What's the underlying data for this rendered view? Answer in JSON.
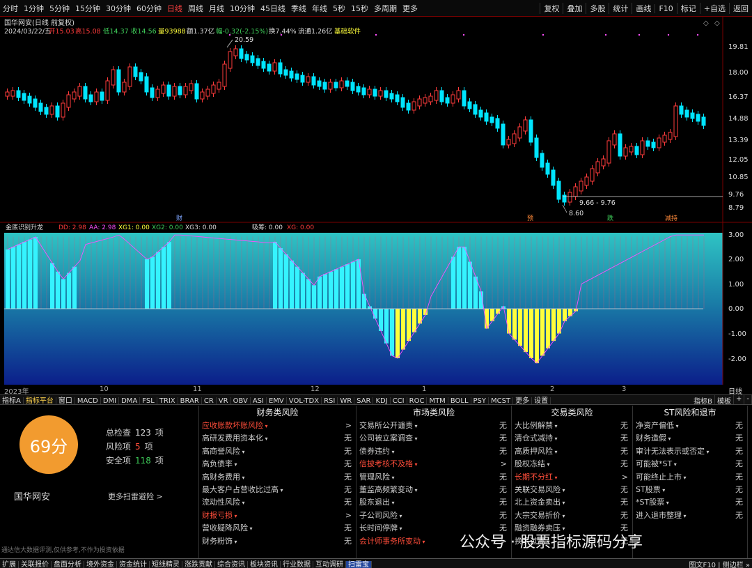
{
  "topbar": {
    "periods": [
      "分时",
      "1分钟",
      "5分钟",
      "15分钟",
      "30分钟",
      "60分钟",
      "日线",
      "周线",
      "月线",
      "10分钟",
      "45日线",
      "季线",
      "年线",
      "5秒",
      "15秒",
      "多周期",
      "更多"
    ],
    "active_period": "日线",
    "tools": [
      "复权",
      "叠加",
      "多股",
      "统计",
      "画线",
      "F10",
      "标记",
      "+自选",
      "返回"
    ]
  },
  "chart_header": {
    "line1": "国华网安(日线 前复权)",
    "date": "2024/03/22/五",
    "open": "开15.03",
    "high": "高15.08",
    "low": "低14.37",
    "close": "收14.56",
    "volume": "量93988",
    "amount": "额1.37亿",
    "change": "幅-0.32(-2.15%)",
    "turnover": "换7.44%",
    "float": "流通1.26亿",
    "sector": "基础软件"
  },
  "price_axis": [
    "19.81",
    "18.00",
    "16.37",
    "14.88",
    "13.39",
    "12.05",
    "10.85",
    "9.76",
    "8.79"
  ],
  "price_annotations": {
    "high_label": "20.59",
    "low_label": "8.60",
    "range_label": "9.66 - 9.76"
  },
  "event_tags": [
    "财",
    "预",
    "跌",
    "减持"
  ],
  "indicator": {
    "name": "金底识别升龙",
    "legend": [
      "DD: 2.98",
      "AA: 2.98",
      "XG1: 0.00",
      "XG2: 0.00",
      "XG3: 0.00",
      "吸筹: 0.00",
      "XG: 0.00"
    ],
    "axis": [
      "3.00",
      "2.00",
      "1.00",
      "0.00",
      "-1.00",
      "-2.00"
    ]
  },
  "date_axis": {
    "labels": [
      "2023年",
      "10",
      "11",
      "12",
      "1",
      "2",
      "3"
    ],
    "right_label": "日线"
  },
  "tabbar": {
    "tabs": [
      "指标A",
      "指标平台",
      "窗口",
      "MACD",
      "DMI",
      "DMA",
      "FSL",
      "TRIX",
      "BRAR",
      "CR",
      "VR",
      "OBV",
      "ASI",
      "EMV",
      "VOL-TDX",
      "RSI",
      "WR",
      "SAR",
      "KDJ",
      "CCI",
      "ROC",
      "MTM",
      "BOLL",
      "PSY",
      "MCST",
      "更多",
      "设置"
    ],
    "active": "指标平台",
    "right": [
      "指标B",
      "模板",
      "+",
      "-"
    ]
  },
  "scan": {
    "score": "69分",
    "stock_name": "国华网安",
    "stats": [
      {
        "label": "总检查",
        "value": "123",
        "unit": "项",
        "color": "#dddddd"
      },
      {
        "label": "风险项",
        "value": "5",
        "unit": "项",
        "color": "#ff4d3a"
      },
      {
        "label": "安全项",
        "value": "118",
        "unit": "项",
        "color": "#3fce5a"
      }
    ],
    "more": "更多扫雷避险 >",
    "disclaimer": "通达信大数据评测,仅供参考,不作为投资依据",
    "columns": [
      {
        "title": "财务类风险",
        "rows": [
          {
            "name": "应收账款坏账风险",
            "status": ">",
            "risk": true
          },
          {
            "name": "高研发费用资本化",
            "status": "无"
          },
          {
            "name": "高商誉风险",
            "status": "无"
          },
          {
            "name": "高负债率",
            "status": "无"
          },
          {
            "name": "高财务费用",
            "status": "无"
          },
          {
            "name": "最大客户占营收比过高",
            "status": "无"
          },
          {
            "name": "流动性风险",
            "status": "无"
          },
          {
            "name": "财报亏损",
            "status": ">",
            "risk": true
          },
          {
            "name": "营收疑降风险",
            "status": "无"
          },
          {
            "name": "财务粉饰",
            "status": "无"
          }
        ]
      },
      {
        "title": "市场类风险",
        "rows": [
          {
            "name": "交易所公开谴责",
            "status": "无"
          },
          {
            "name": "公司被立案调查",
            "status": "无"
          },
          {
            "name": "债券违约",
            "status": "无"
          },
          {
            "name": "信披考核不及格",
            "status": ">",
            "risk": true
          },
          {
            "name": "管理风险",
            "status": "无"
          },
          {
            "name": "董监高频繁变动",
            "status": "无"
          },
          {
            "name": "股东退出",
            "status": "无"
          },
          {
            "name": "子公司风险",
            "status": "无"
          },
          {
            "name": "长时间停牌",
            "status": "无"
          },
          {
            "name": "会计师事务所变动",
            "status": ">",
            "risk": true
          }
        ]
      },
      {
        "title": "交易类风险",
        "rows": [
          {
            "name": "大比例解禁",
            "status": "无"
          },
          {
            "name": "清仓式减持",
            "status": "无"
          },
          {
            "name": "高质押风险",
            "status": "无"
          },
          {
            "name": "股权冻结",
            "status": "无"
          },
          {
            "name": "长期不分红",
            "status": ">",
            "risk": true
          },
          {
            "name": "关联交易风险",
            "status": "无"
          },
          {
            "name": "北上资金卖出",
            "status": "无"
          },
          {
            "name": "大宗交易折价",
            "status": "无"
          },
          {
            "name": "融资融券卖压",
            "status": "无"
          },
          {
            "name": "换手过高",
            "status": "无"
          }
        ]
      },
      {
        "title": "ST风险和退市",
        "rows": [
          {
            "name": "净资产偏低",
            "status": "无"
          },
          {
            "name": "财务造假",
            "status": "无"
          },
          {
            "name": "审计无法表示或否定",
            "status": "无"
          },
          {
            "name": "可能被*ST",
            "status": "无"
          },
          {
            "name": "可能终止上市",
            "status": "无"
          },
          {
            "name": "ST股票",
            "status": "无"
          },
          {
            "name": "*ST股票",
            "status": "无"
          },
          {
            "name": "进入退市整理",
            "status": "无"
          }
        ]
      }
    ]
  },
  "watermark": "公众号 · 股票指标源码分享",
  "bottombar": {
    "tabs": [
      "扩展",
      "关联报价",
      "盘面分析",
      "境外资金",
      "资金统计",
      "短线精灵",
      "涨跌贡献",
      "综合资讯",
      "板块资讯",
      "行业数据",
      "互动调研",
      "扫雷宝"
    ],
    "active": "扫雷宝",
    "right": "图文F10 | 侧边栏 »"
  },
  "colors": {
    "up": "#ff3b3b",
    "down": "#00e5ff",
    "yellow": "#ffff3b",
    "risk": "#ff4d3a",
    "accent": "#f29b2f"
  }
}
